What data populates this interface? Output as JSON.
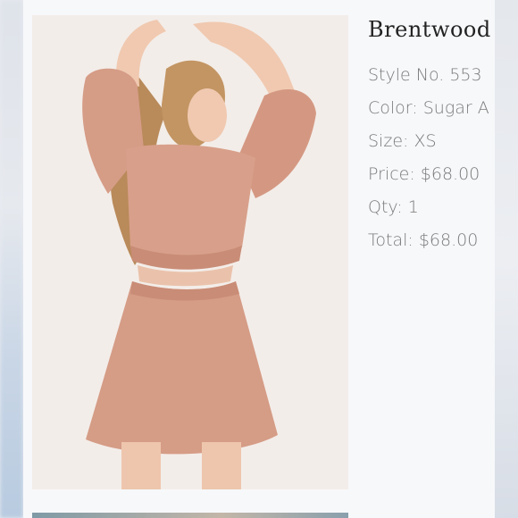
{
  "product": {
    "title": "Brentwood",
    "style": "Style No. 553",
    "color": "Color: Sugar A",
    "size": "Size: XS",
    "price": "Price: $68.00",
    "qty": "Qty: 1",
    "total": "Total: $68.00"
  },
  "photo": {
    "subject": "model-in-pink-cutout-dress",
    "dress_color": "#d49a84",
    "background_color": "#f2ece8"
  }
}
